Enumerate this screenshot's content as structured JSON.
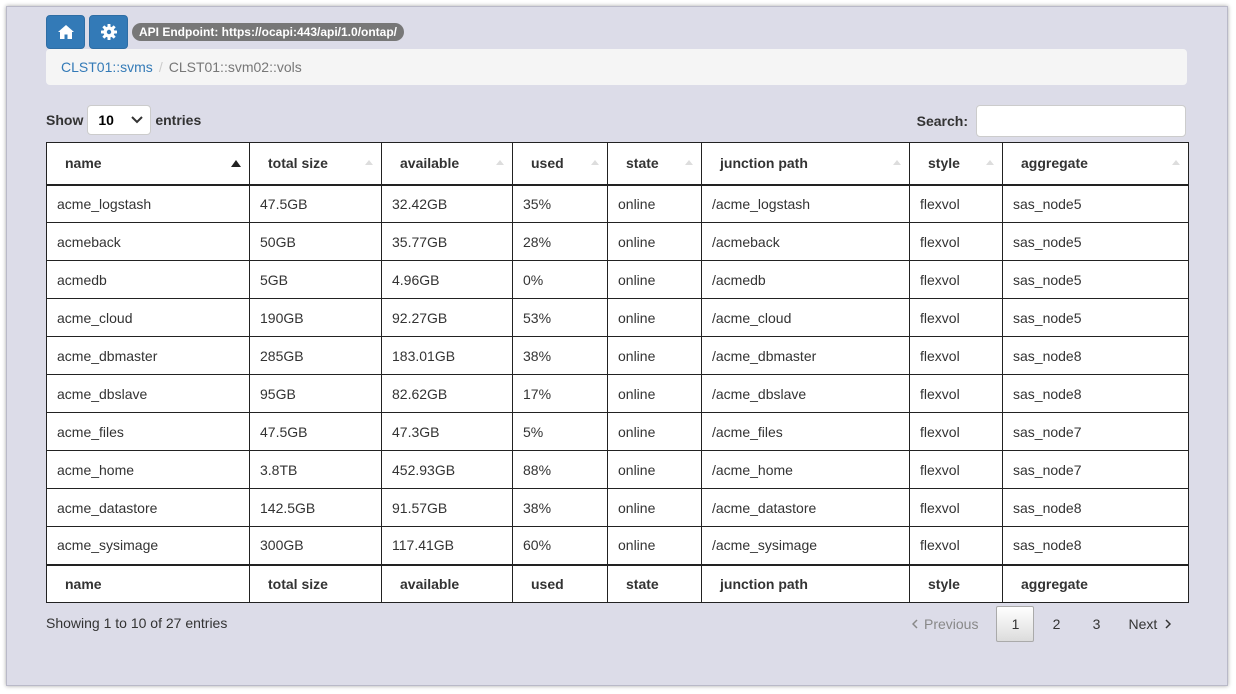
{
  "toolbar": {
    "home_icon": "home-icon",
    "settings_icon": "gear-icon",
    "api_endpoint": "API Endpoint: https://ocapi:443/api/1.0/ontap/"
  },
  "breadcrumb": {
    "parent": "CLST01::svms",
    "separator": "/",
    "current": "CLST01::svm02::vols"
  },
  "length": {
    "show": "Show",
    "value": "10",
    "entries": "entries"
  },
  "search": {
    "label": "Search:",
    "value": ""
  },
  "table": {
    "columns": [
      "name",
      "total size",
      "available",
      "used",
      "state",
      "junction path",
      "style",
      "aggregate"
    ],
    "rows": [
      [
        "acme_logstash",
        "47.5GB",
        "32.42GB",
        "35%",
        "online",
        "/acme_logstash",
        "flexvol",
        "sas_node5"
      ],
      [
        "acmeback",
        "50GB",
        "35.77GB",
        "28%",
        "online",
        "/acmeback",
        "flexvol",
        "sas_node5"
      ],
      [
        "acmedb",
        "5GB",
        "4.96GB",
        "0%",
        "online",
        "/acmedb",
        "flexvol",
        "sas_node5"
      ],
      [
        "acme_cloud",
        "190GB",
        "92.27GB",
        "53%",
        "online",
        "/acme_cloud",
        "flexvol",
        "sas_node5"
      ],
      [
        "acme_dbmaster",
        "285GB",
        "183.01GB",
        "38%",
        "online",
        "/acme_dbmaster",
        "flexvol",
        "sas_node8"
      ],
      [
        "acme_dbslave",
        "95GB",
        "82.62GB",
        "17%",
        "online",
        "/acme_dbslave",
        "flexvol",
        "sas_node8"
      ],
      [
        "acme_files",
        "47.5GB",
        "47.3GB",
        "5%",
        "online",
        "/acme_files",
        "flexvol",
        "sas_node7"
      ],
      [
        "acme_home",
        "3.8TB",
        "452.93GB",
        "88%",
        "online",
        "/acme_home",
        "flexvol",
        "sas_node7"
      ],
      [
        "acme_datastore",
        "142.5GB",
        "91.57GB",
        "38%",
        "online",
        "/acme_datastore",
        "flexvol",
        "sas_node8"
      ],
      [
        "acme_sysimage",
        "300GB",
        "117.41GB",
        "60%",
        "online",
        "/acme_sysimage",
        "flexvol",
        "sas_node8"
      ]
    ]
  },
  "footer": {
    "info": "Showing 1 to 10 of 27 entries",
    "previous": "Previous",
    "pages": [
      "1",
      "2",
      "3"
    ],
    "next": "Next"
  },
  "colors": {
    "primary": "#337ab7",
    "background": "#dcdce8",
    "badge": "#777777"
  }
}
